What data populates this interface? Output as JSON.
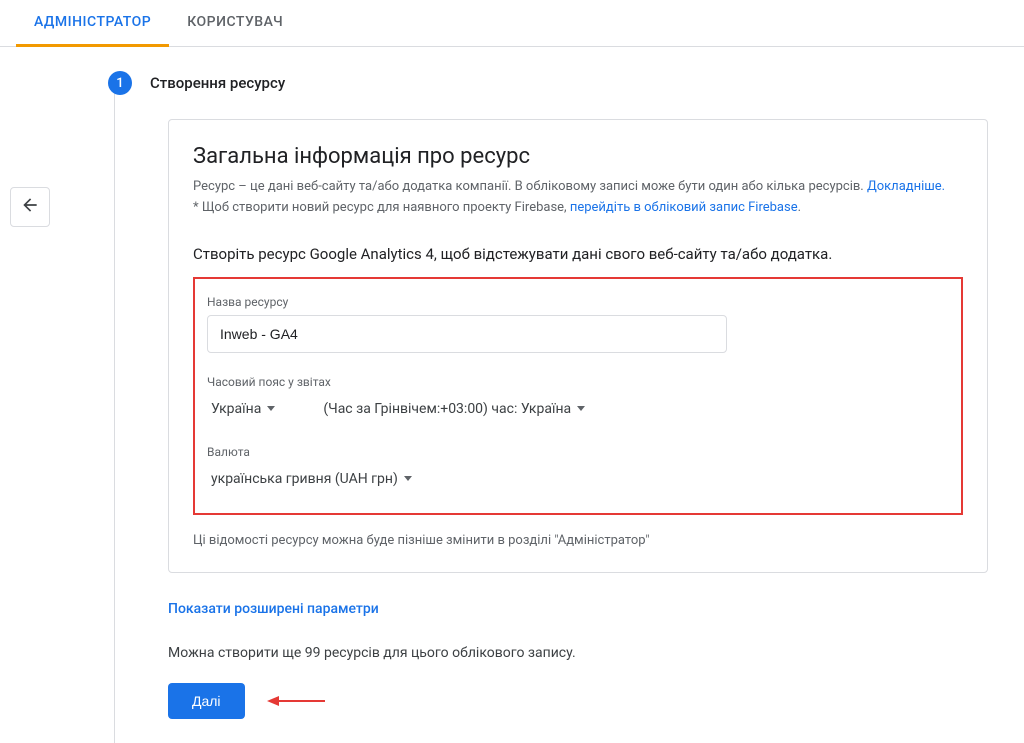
{
  "tabs": {
    "admin": "АДМІНІСТРАТОР",
    "user": "КОРИСТУВАЧ"
  },
  "step": {
    "number": "1",
    "title": "Створення ресурсу"
  },
  "general": {
    "heading": "Загальна інформація про ресурс",
    "desc1_a": "Ресурс – це дані веб-сайту та/або додатка компанії. В обліковому записі може бути один або кілька ресурсів. ",
    "link1": "Докладніше.",
    "desc2_a": "* Щоб створити новий ресурс для наявного проекту Firebase, ",
    "link2": "перейдіть в обліковий запис Firebase",
    "desc2_b": "."
  },
  "lead": "Створіть ресурс Google Analytics 4, щоб відстежувати дані свого веб-сайту та/або додатка.",
  "form": {
    "name_label": "Назва ресурсу",
    "name_value": "Inweb - GA4",
    "tz_label": "Часовий пояс у звітах",
    "country": "Україна",
    "tz_value": "(Час за Грінвічем:+03:00) час: Україна",
    "currency_label": "Валюта",
    "currency_value": "українська гривня (UAH грн)"
  },
  "hint": "Ці відомості ресурсу можна буде пізніше змінити в розділі \"Адміністратор\"",
  "advanced": "Показати розширені параметри",
  "limit": "Можна створити ще 99 ресурсів для цього облікового запису.",
  "next": "Далі"
}
